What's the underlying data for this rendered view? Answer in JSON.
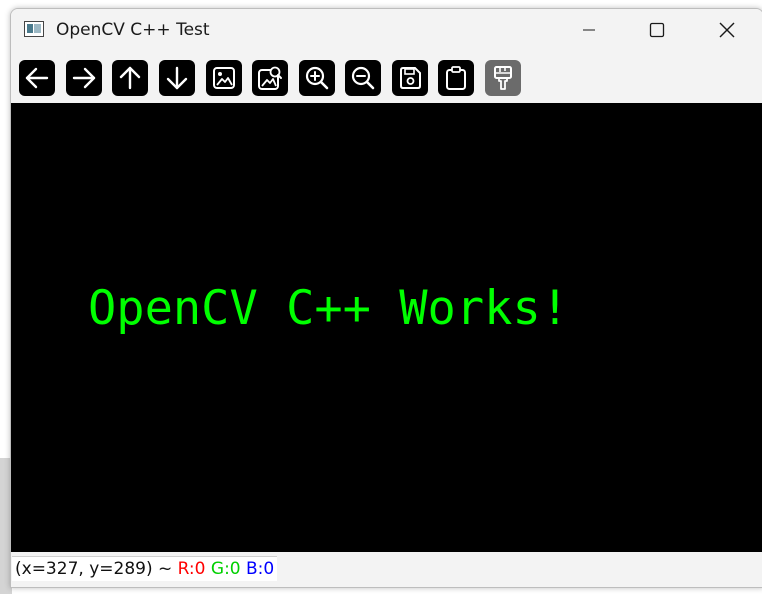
{
  "window": {
    "title": "OpenCV C++ Test"
  },
  "toolbar": {
    "buttons": [
      {
        "name": "pan-left-button",
        "icon": "arrow-left-icon"
      },
      {
        "name": "pan-right-button",
        "icon": "arrow-right-icon"
      },
      {
        "name": "pan-up-button",
        "icon": "arrow-up-icon"
      },
      {
        "name": "pan-down-button",
        "icon": "arrow-down-icon"
      },
      {
        "name": "zoom-original-button",
        "icon": "image-icon"
      },
      {
        "name": "zoom-fit-button",
        "icon": "image-zoom-icon"
      },
      {
        "name": "zoom-in-button",
        "icon": "zoom-in-icon"
      },
      {
        "name": "zoom-out-button",
        "icon": "zoom-out-icon"
      },
      {
        "name": "save-image-button",
        "icon": "floppy-disk-icon"
      },
      {
        "name": "copy-clipboard-button",
        "icon": "clipboard-icon"
      },
      {
        "name": "properties-button",
        "icon": "paint-brush-icon",
        "disabled": true
      }
    ]
  },
  "canvas": {
    "text": "OpenCV C++ Works!",
    "text_color": "#00ff00",
    "background": "#000000"
  },
  "status": {
    "coords": "(x=327, y=289) ~ ",
    "r": "R:0",
    "g": "G:0",
    "b": "B:0",
    "r_color": "#ff0000",
    "g_color": "#00d000",
    "b_color": "#0000ff"
  }
}
